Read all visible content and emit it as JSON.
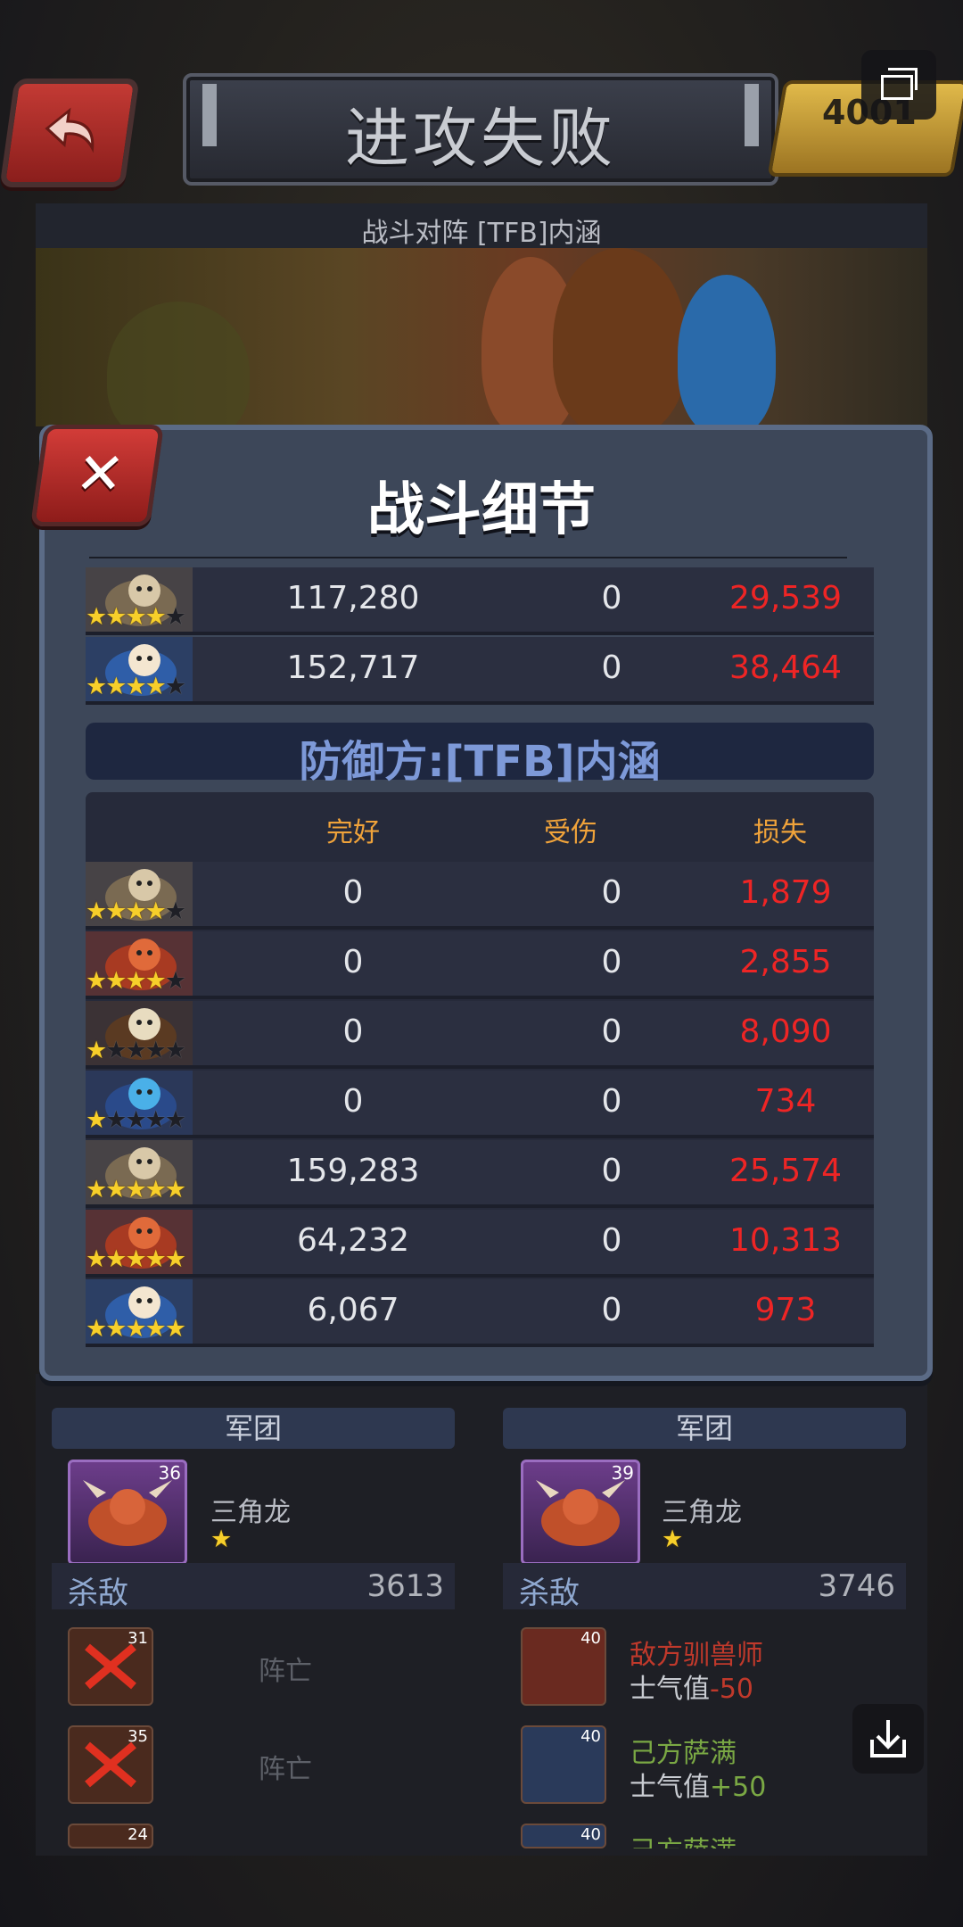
{
  "header": {
    "title": "进攻失败",
    "gold": "4001",
    "battle_label": "战斗对阵 [TFB]内涵"
  },
  "modal": {
    "title": "战斗细节",
    "defender_label": "防御方:[TFB]内涵",
    "columns": [
      "完好",
      "受伤",
      "损失"
    ],
    "attacker_rows": [
      {
        "unit": "skull-beast",
        "stars": 4,
        "max_stars": 5,
        "intact": "117,280",
        "injured": "0",
        "lost": "29,539"
      },
      {
        "unit": "blue-shaman",
        "stars": 4,
        "max_stars": 5,
        "intact": "152,717",
        "injured": "0",
        "lost": "38,464"
      }
    ],
    "defender_rows": [
      {
        "unit": "skull-beast",
        "stars": 4,
        "max_stars": 5,
        "intact": "0",
        "injured": "0",
        "lost": "1,879"
      },
      {
        "unit": "red-dino",
        "stars": 4,
        "max_stars": 5,
        "intact": "0",
        "injured": "0",
        "lost": "2,855"
      },
      {
        "unit": "caveman-club",
        "stars": 1,
        "max_stars": 5,
        "intact": "0",
        "injured": "0",
        "lost": "8,090"
      },
      {
        "unit": "blue-mage",
        "stars": 1,
        "max_stars": 5,
        "intact": "0",
        "injured": "0",
        "lost": "734"
      },
      {
        "unit": "skull-beast",
        "stars": 5,
        "max_stars": 5,
        "intact": "159,283",
        "injured": "0",
        "lost": "25,574"
      },
      {
        "unit": "red-dino",
        "stars": 5,
        "max_stars": 5,
        "intact": "64,232",
        "injured": "0",
        "lost": "10,313"
      },
      {
        "unit": "blue-shaman",
        "stars": 5,
        "max_stars": 5,
        "intact": "6,067",
        "injured": "0",
        "lost": "973"
      }
    ]
  },
  "lower": {
    "left": {
      "legion_label": "军团",
      "unit_name": "三角龙",
      "unit_level": "36",
      "kill_label": "杀敌",
      "kill_value": "3613",
      "items": [
        {
          "level": "31",
          "status": "阵亡"
        },
        {
          "level": "35",
          "status": "阵亡"
        },
        {
          "level": "24"
        }
      ]
    },
    "right": {
      "legion_label": "军团",
      "unit_name": "三角龙",
      "unit_level": "39",
      "kill_label": "杀敌",
      "kill_value": "3746",
      "items": [
        {
          "level": "40",
          "name": "敌方驯兽师",
          "stat": "士气值",
          "delta": "-50"
        },
        {
          "level": "40",
          "name": "己方萨满",
          "stat": "士气值",
          "delta": "+50"
        },
        {
          "level": "40",
          "name": "己方萨满"
        }
      ]
    }
  },
  "colors": {
    "loss_red": "#ee2525",
    "header_orange": "#f0a33a",
    "defender_blue": "#7d99d8",
    "star_gold": "#f7cf2a"
  }
}
